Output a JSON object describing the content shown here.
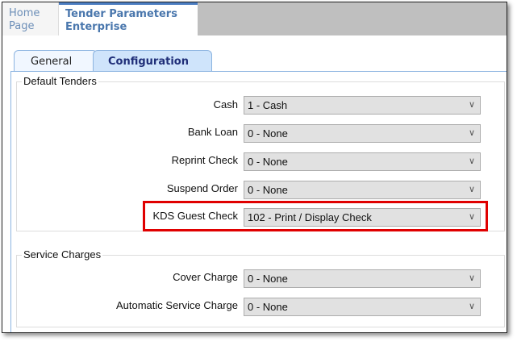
{
  "top_tabs": [
    {
      "label_line1": "Home",
      "label_line2": "Page"
    },
    {
      "label_line1": "Tender Parameters",
      "label_line2": "Enterprise"
    }
  ],
  "sub_tabs": {
    "general": "General",
    "configuration": "Configuration"
  },
  "default_tenders": {
    "title": "Default Tenders",
    "rows": [
      {
        "label": "Cash",
        "value": "1 - Cash"
      },
      {
        "label": "Bank Loan",
        "value": "0 - None"
      },
      {
        "label": "Reprint Check",
        "value": "0 - None"
      },
      {
        "label": "Suspend Order",
        "value": "0 - None"
      },
      {
        "label": "KDS Guest Check",
        "value": "102 - Print / Display Check"
      }
    ]
  },
  "service_charges": {
    "title": "Service Charges",
    "rows": [
      {
        "label": "Cover Charge",
        "value": "0 - None"
      },
      {
        "label": "Automatic Service Charge",
        "value": "0 - None"
      }
    ]
  },
  "highlight_color": "#e00000"
}
